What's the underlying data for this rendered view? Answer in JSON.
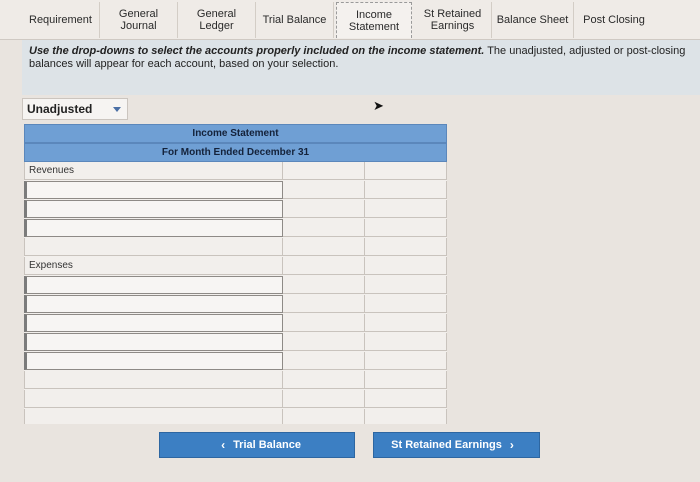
{
  "tabs": [
    {
      "label": "Requirement"
    },
    {
      "label": "General\nJournal"
    },
    {
      "label": "General\nLedger"
    },
    {
      "label": "Trial Balance"
    },
    {
      "label": "Income\nStatement"
    },
    {
      "label": "St Retained\nEarnings"
    },
    {
      "label": "Balance Sheet"
    },
    {
      "label": "Post Closing"
    }
  ],
  "instruction": {
    "bold": "Use the drop-downs to select the accounts properly included on the income statement.",
    "rest": " The unadjusted, adjusted or post-closing balances will appear for each account, based on your selection."
  },
  "dropdown": {
    "value": "Unadjusted"
  },
  "statement": {
    "title": "Income Statement",
    "period": "For Month Ended December 31",
    "revenues_label": "Revenues",
    "expenses_label": "Expenses"
  },
  "nav": {
    "prev_label": "Trial Balance",
    "next_label": "St Retained Earnings",
    "prev_arrow": "‹",
    "next_arrow": "›"
  },
  "colors": {
    "accent": "#3c7fc3",
    "header": "#6f9fd4"
  }
}
